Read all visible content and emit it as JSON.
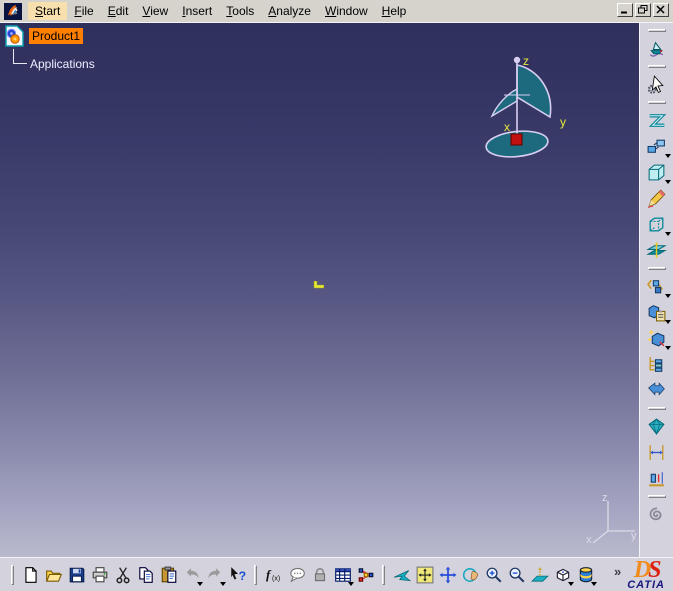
{
  "menu": {
    "items": [
      {
        "label": "Start",
        "highlighted": true
      },
      {
        "label": "File",
        "highlighted": false
      },
      {
        "label": "Edit",
        "highlighted": false
      },
      {
        "label": "View",
        "highlighted": false
      },
      {
        "label": "Insert",
        "highlighted": false
      },
      {
        "label": "Tools",
        "highlighted": false
      },
      {
        "label": "Analyze",
        "highlighted": false
      },
      {
        "label": "Window",
        "highlighted": false
      },
      {
        "label": "Help",
        "highlighted": false
      }
    ]
  },
  "window": {
    "buttons": [
      {
        "name": "minimize-button",
        "icon": "minimize-icon"
      },
      {
        "name": "restore-button",
        "icon": "restore-icon"
      },
      {
        "name": "close-button",
        "icon": "close-icon"
      }
    ]
  },
  "tree": {
    "root_label": "Product1",
    "child_label": "Applications",
    "root_highlight_color": "#ff8000"
  },
  "compass": {
    "labels": {
      "x": "x",
      "y": "y",
      "z": "z"
    }
  },
  "axis_triad": {
    "labels": {
      "x": "x",
      "y": "y",
      "z": "z"
    }
  },
  "right_toolbar": {
    "items": [
      {
        "type": "handle"
      },
      {
        "type": "button",
        "name": "fly-through-button",
        "icon": "fly-through-icon",
        "dropdown": false
      },
      {
        "type": "handle"
      },
      {
        "type": "button",
        "name": "select-button",
        "icon": "select-gear-icon",
        "dropdown": false
      },
      {
        "type": "handle"
      },
      {
        "type": "button",
        "name": "scenes-button",
        "icon": "scenes-icon",
        "dropdown": false
      },
      {
        "type": "button",
        "name": "cameras-button",
        "icon": "cameras-icon",
        "dropdown": true
      },
      {
        "type": "button",
        "name": "view-box-button",
        "icon": "view-box-icon",
        "dropdown": true
      },
      {
        "type": "button",
        "name": "annotations-button",
        "icon": "annotation-pencil-icon",
        "dropdown": false
      },
      {
        "type": "button",
        "name": "wireframe-box-button",
        "icon": "wireframe-box-icon",
        "dropdown": true
      },
      {
        "type": "button",
        "name": "clipping-planes-button",
        "icon": "clipping-planes-icon",
        "dropdown": false
      },
      {
        "type": "handle"
      },
      {
        "type": "button",
        "name": "insert-component-button",
        "icon": "components-icon",
        "dropdown": true
      },
      {
        "type": "button",
        "name": "existing-component-button",
        "icon": "component-clipboard-icon",
        "dropdown": true
      },
      {
        "type": "button",
        "name": "fast-instantiation-button",
        "icon": "sparkle-box-icon",
        "dropdown": true
      },
      {
        "type": "button",
        "name": "graph-tree-button",
        "icon": "graph-tree-icon",
        "dropdown": false
      },
      {
        "type": "button",
        "name": "publications-button",
        "icon": "publications-icon",
        "dropdown": false
      },
      {
        "type": "handle"
      },
      {
        "type": "button",
        "name": "material-button",
        "icon": "gem-icon",
        "dropdown": false
      },
      {
        "type": "button",
        "name": "measure-between-button",
        "icon": "measure-between-icon",
        "dropdown": false
      },
      {
        "type": "button",
        "name": "measure-item-button",
        "icon": "measure-item-icon",
        "dropdown": false
      },
      {
        "type": "handle"
      },
      {
        "type": "button",
        "name": "catalog-browser-button",
        "icon": "catalog-icon",
        "dropdown": false
      }
    ]
  },
  "bottom_toolbar": {
    "groups": [
      {
        "name": "standard",
        "items": [
          {
            "name": "new-button",
            "icon": "new-document-icon",
            "dropdown": false,
            "disabled": false
          },
          {
            "name": "open-button",
            "icon": "open-folder-icon",
            "dropdown": false,
            "disabled": false
          },
          {
            "name": "save-button",
            "icon": "save-icon",
            "dropdown": false,
            "disabled": false
          },
          {
            "name": "print-button",
            "icon": "print-icon",
            "dropdown": false,
            "disabled": false
          },
          {
            "name": "cut-button",
            "icon": "cut-icon",
            "dropdown": false,
            "disabled": false
          },
          {
            "name": "copy-button",
            "icon": "copy-icon",
            "dropdown": false,
            "disabled": false
          },
          {
            "name": "paste-button",
            "icon": "paste-icon",
            "dropdown": false,
            "disabled": false
          },
          {
            "name": "undo-button",
            "icon": "undo-icon",
            "dropdown": true,
            "disabled": true
          },
          {
            "name": "redo-button",
            "icon": "redo-icon",
            "dropdown": true,
            "disabled": true
          },
          {
            "name": "whats-this-button",
            "icon": "whats-this-icon",
            "dropdown": false,
            "disabled": false
          }
        ]
      },
      {
        "name": "knowledge",
        "items": [
          {
            "name": "formula-button",
            "icon": "formula-icon",
            "dropdown": false,
            "disabled": false
          },
          {
            "name": "comment-button",
            "icon": "comment-icon",
            "dropdown": false,
            "disabled": false
          },
          {
            "name": "lock-button",
            "icon": "lock-icon",
            "dropdown": false,
            "disabled": true
          },
          {
            "name": "design-table-button",
            "icon": "design-table-icon",
            "dropdown": true,
            "disabled": false
          },
          {
            "name": "relations-button",
            "icon": "relations-icon",
            "dropdown": false,
            "disabled": false
          }
        ]
      },
      {
        "name": "view",
        "items": [
          {
            "name": "fly-mode-button",
            "icon": "fly-plane-icon",
            "dropdown": false,
            "disabled": false
          },
          {
            "name": "fit-all-in-button",
            "icon": "fit-all-icon",
            "dropdown": false,
            "disabled": false
          },
          {
            "name": "pan-button",
            "icon": "pan-icon",
            "dropdown": false,
            "disabled": false
          },
          {
            "name": "rotate-button",
            "icon": "rotate-icon",
            "dropdown": false,
            "disabled": false
          },
          {
            "name": "zoom-in-button",
            "icon": "zoom-in-icon",
            "dropdown": false,
            "disabled": false
          },
          {
            "name": "zoom-out-button",
            "icon": "zoom-out-icon",
            "dropdown": false,
            "disabled": false
          },
          {
            "name": "normal-view-button",
            "icon": "normal-view-icon",
            "dropdown": false,
            "disabled": false
          },
          {
            "name": "quick-view-button",
            "icon": "quick-view-icon",
            "dropdown": true,
            "disabled": false
          },
          {
            "name": "render-style-button",
            "icon": "render-style-icon",
            "dropdown": true,
            "disabled": false
          }
        ]
      }
    ],
    "overflow_chevron": "»",
    "logo": {
      "ds": "DS",
      "catia": "CATIA"
    }
  },
  "colors": {
    "selection_orange": "#ff8000",
    "menu_highlight": "#f7dfae",
    "viewport_top": "#30305c",
    "viewport_bottom": "#b9b9cd",
    "compass_fill": "#1d6a7e",
    "compass_outline": "#d8cef2",
    "axis_label_yellow": "#e8e83a",
    "toolbar_gray": "#d4d2dc"
  }
}
